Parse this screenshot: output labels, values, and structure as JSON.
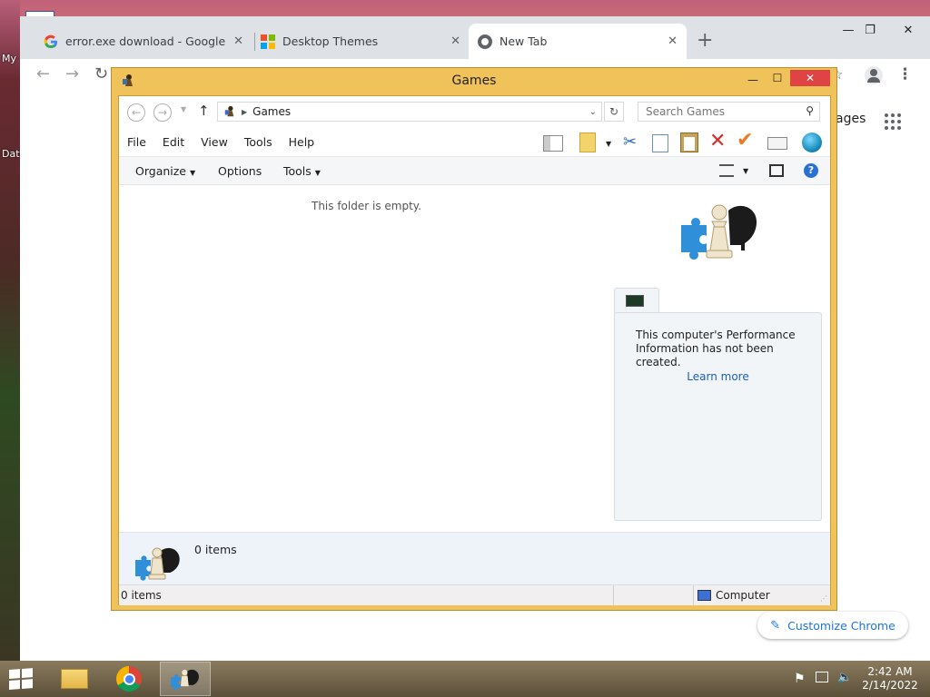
{
  "desktop": {
    "left_labels": [
      "My",
      "Dat"
    ]
  },
  "browser": {
    "tabs": [
      {
        "title": "error.exe download - Google Sea",
        "favicon": "google-g-icon",
        "active": false
      },
      {
        "title": "Desktop Themes",
        "favicon": "windows-logo-icon",
        "active": false
      },
      {
        "title": "New Tab",
        "favicon": "chrome-icon",
        "active": true
      }
    ],
    "partial_link_text": "ages",
    "customize_label": "Customize Chrome"
  },
  "explorer": {
    "title": "Games",
    "breadcrumb": "Games",
    "search_placeholder": "Search Games",
    "menu": [
      "File",
      "Edit",
      "View",
      "Tools",
      "Help"
    ],
    "commands": {
      "organize": "Organize",
      "options": "Options",
      "tools": "Tools"
    },
    "empty_message": "This folder is empty.",
    "performance_text": "This computer's Performance Information has not been created.",
    "learn_more": "Learn more",
    "details_count": "0 items",
    "status_count": "0 items",
    "status_location": "Computer"
  },
  "taskbar": {
    "time": "2:42 AM",
    "date": "2/14/2022"
  },
  "colors": {
    "window_frame": "#f0c25a",
    "close_red": "#e04343",
    "link_blue": "#1a5fb4",
    "chrome_blue": "#1a73e8"
  }
}
